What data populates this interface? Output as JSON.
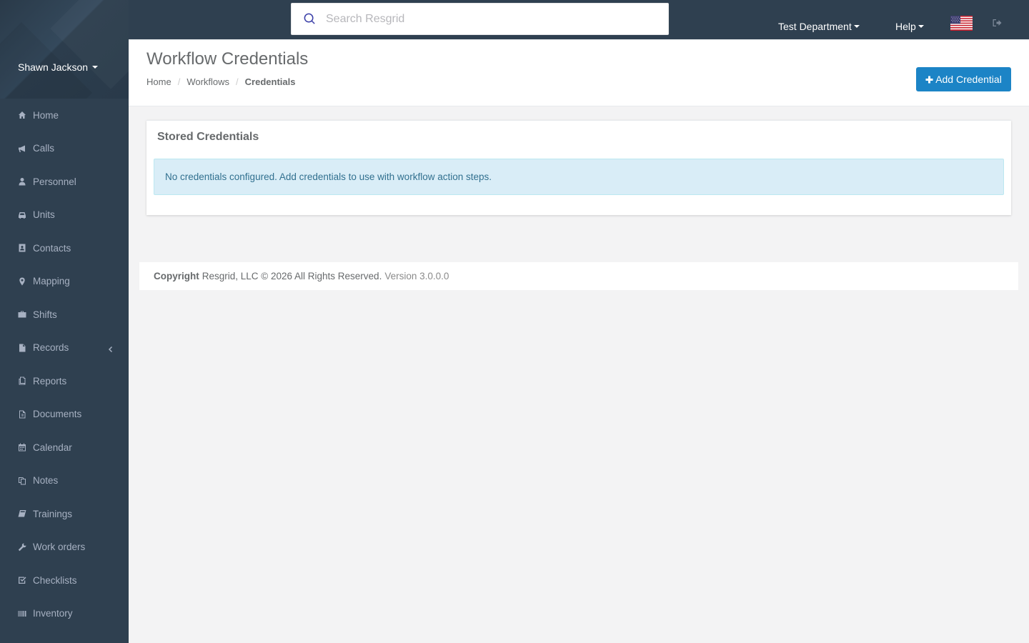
{
  "user": {
    "name": "Shawn Jackson"
  },
  "sidebar": {
    "items": [
      {
        "label": "Home",
        "icon": "home-icon"
      },
      {
        "label": "Calls",
        "icon": "bullhorn-icon"
      },
      {
        "label": "Personnel",
        "icon": "user-icon"
      },
      {
        "label": "Units",
        "icon": "truck-icon"
      },
      {
        "label": "Contacts",
        "icon": "address-book-icon"
      },
      {
        "label": "Mapping",
        "icon": "map-marker-icon"
      },
      {
        "label": "Shifts",
        "icon": "briefcase-icon"
      },
      {
        "label": "Records",
        "icon": "file-icon",
        "has_submenu": true
      },
      {
        "label": "Reports",
        "icon": "report-icon"
      },
      {
        "label": "Documents",
        "icon": "document-icon"
      },
      {
        "label": "Calendar",
        "icon": "calendar-icon"
      },
      {
        "label": "Notes",
        "icon": "notes-icon"
      },
      {
        "label": "Trainings",
        "icon": "book-icon"
      },
      {
        "label": "Work orders",
        "icon": "wrench-icon"
      },
      {
        "label": "Checklists",
        "icon": "checkbox-icon"
      },
      {
        "label": "Inventory",
        "icon": "barcode-icon"
      }
    ]
  },
  "topbar": {
    "search_placeholder": "Search Resgrid",
    "department": "Test Department",
    "help": "Help",
    "flag": "us-flag-icon",
    "logout": "logout-icon"
  },
  "page": {
    "title": "Workflow Credentials",
    "breadcrumb": [
      "Home",
      "Workflows",
      "Credentials"
    ],
    "add_button": "Add Credential"
  },
  "panel": {
    "title": "Stored Credentials",
    "alert": "No credentials configured. Add credentials to use with workflow action steps."
  },
  "footer": {
    "copyright_label": "Copyright",
    "text": "Resgrid, LLC © 2026 All Rights Reserved.",
    "version": "Version 3.0.0.0"
  },
  "colors": {
    "sidebar_bg": "#2f4050",
    "accent_button": "#1c84c6",
    "alert_bg": "#d9edf7",
    "alert_text": "#31708f"
  }
}
